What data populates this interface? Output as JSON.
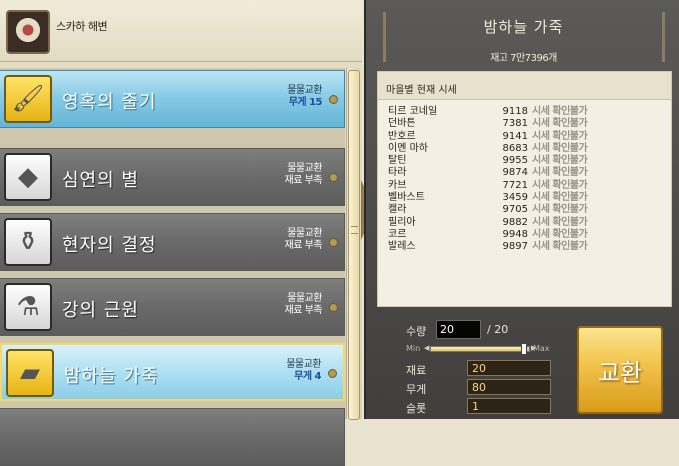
{
  "npc": {
    "name": "스카하 해변"
  },
  "items": [
    {
      "name": "영혹의 줄기",
      "type": "물물교환",
      "sub": "무게 15",
      "state": "selected",
      "icon": "brush-bundle-icon",
      "icon_glyph": "🖌"
    },
    {
      "name": "심연의 별",
      "type": "물물교환",
      "sub": "재료 부족",
      "state": "normal",
      "icon": "dark-crystal-icon",
      "icon_glyph": "◆"
    },
    {
      "name": "현자의 결정",
      "type": "물물교환",
      "sub": "재료 부족",
      "state": "normal",
      "icon": "potion-bottle-icon",
      "icon_glyph": "⚱"
    },
    {
      "name": "강의 근원",
      "type": "물물교환",
      "sub": "재료 부족",
      "state": "normal",
      "icon": "glass-bottle-icon",
      "icon_glyph": "⚗"
    },
    {
      "name": "밤하늘 가죽",
      "type": "물물교환",
      "sub": "무게 4",
      "state": "highlight",
      "icon": "night-leather-icon",
      "icon_glyph": "▰"
    }
  ],
  "detail": {
    "title": "밤하늘 가죽",
    "stock": "재고 7만7396개",
    "price_header": "마을별 현재 시세",
    "prices": [
      {
        "town": "티르 코네일",
        "price": "9118",
        "status": "시세 확인불가"
      },
      {
        "town": "던바튼",
        "price": "7381",
        "status": "시세 확인불가"
      },
      {
        "town": "반호르",
        "price": "9141",
        "status": "시세 확인불가"
      },
      {
        "town": "이멘 마하",
        "price": "8683",
        "status": "시세 확인불가"
      },
      {
        "town": "탈틴",
        "price": "9955",
        "status": "시세 확인불가"
      },
      {
        "town": "타라",
        "price": "9874",
        "status": "시세 확인불가"
      },
      {
        "town": "카브",
        "price": "7721",
        "status": "시세 확인불가"
      },
      {
        "town": "벨바스트",
        "price": "3459",
        "status": "시세 확인불가"
      },
      {
        "town": "켈라",
        "price": "9705",
        "status": "시세 확인불가"
      },
      {
        "town": "필리아",
        "price": "9882",
        "status": "시세 확인불가"
      },
      {
        "town": "코르",
        "price": "9948",
        "status": "시세 확인불가"
      },
      {
        "town": "발레스",
        "price": "9897",
        "status": "시세 확인불가"
      }
    ]
  },
  "quantity": {
    "label": "수량",
    "value": "20",
    "max_text": "/ 20",
    "min_label": "Min",
    "max_label": "Max",
    "slider_fraction": 0.95
  },
  "stats": [
    {
      "label": "재료",
      "value": "20"
    },
    {
      "label": "무게",
      "value": "80"
    },
    {
      "label": "슬롯",
      "value": "1"
    }
  ],
  "exchange_button": "교환"
}
